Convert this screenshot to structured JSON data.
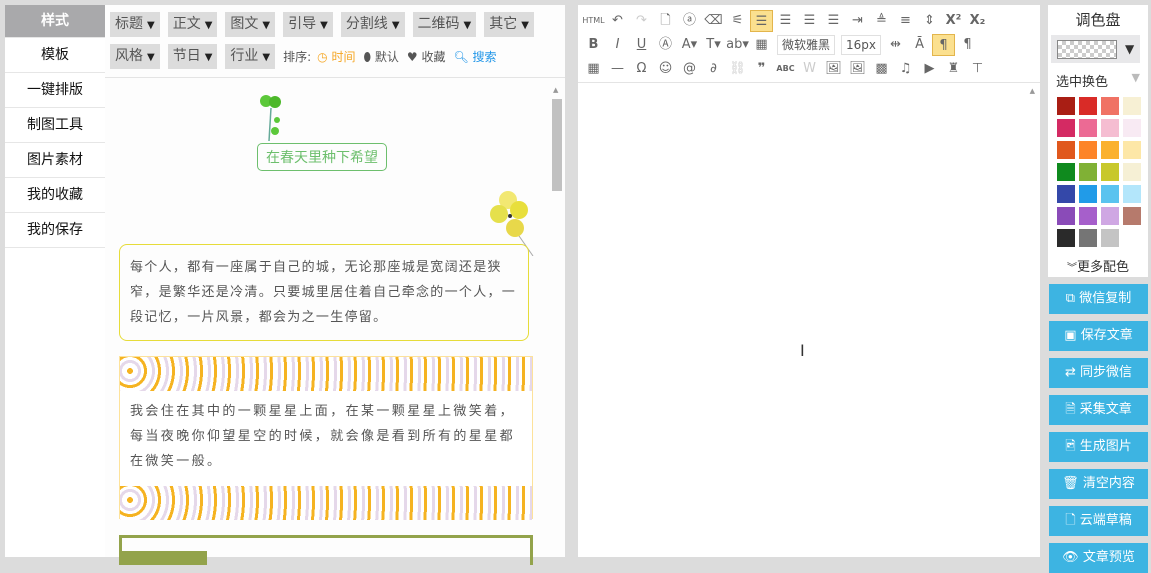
{
  "sidebar": {
    "items": [
      "样式",
      "模板",
      "一键排版",
      "制图工具",
      "图片素材",
      "我的收藏",
      "我的保存"
    ]
  },
  "tags": {
    "row1": [
      "标题",
      "正文",
      "图文",
      "引导",
      "分割线",
      "二维码",
      "其它"
    ],
    "row2": [
      "风格",
      "节日",
      "行业"
    ],
    "sort_label": "排序:",
    "sort_options": [
      "时间",
      "默认",
      "收藏"
    ],
    "search": "搜索"
  },
  "content": {
    "title": "在春天里种下希望",
    "card1": "每个人，都有一座属于自己的城，无论那座城是宽阔还是狭窄，是繁华还是冷清。只要城里居住着自己牵念的一个人，一段记忆，一片风景，都会为之一生停留。",
    "card2": "我会住在其中的一颗星星上面，在某一颗星星上微笑着，每当夜晚你仰望星空的时候，就会像是看到所有的星星都在微笑一般。"
  },
  "editor": {
    "html_btn": "HTML",
    "font_family": "微软雅黑",
    "font_size": "16px"
  },
  "palette": {
    "title": "调色盘",
    "subtitle": "选中换色",
    "more": "更多配色",
    "colors": [
      "#a91e14",
      "#d92b27",
      "#f07264",
      "#f7f0d4",
      "#d42a63",
      "#ec6a94",
      "#f5bdd1",
      "#f8eaf3",
      "#e0581d",
      "#fd8428",
      "#fbb12d",
      "#fde7a7",
      "#0f8a1e",
      "#80b135",
      "#c8c82b",
      "#f6f0d5",
      "#3448a9",
      "#219be8",
      "#5ac3ef",
      "#b3e6fb",
      "#8a4bb8",
      "#a65fcb",
      "#cfa7e3",
      "#b67a6c",
      "#2a2a2a",
      "#757575",
      "#c4c4c4"
    ]
  },
  "actions": [
    {
      "icon": "copy-icon",
      "glyph": "⧉",
      "label": "微信复制"
    },
    {
      "icon": "save-icon",
      "glyph": "▣",
      "label": "保存文章"
    },
    {
      "icon": "sync-icon",
      "glyph": "⇄",
      "label": "同步微信"
    },
    {
      "icon": "collect-icon",
      "glyph": "🗎",
      "label": "采集文章"
    },
    {
      "icon": "image-icon",
      "glyph": "🖻",
      "label": "生成图片"
    },
    {
      "icon": "trash-icon",
      "glyph": "🗑",
      "label": "清空内容"
    },
    {
      "icon": "cloud-draft-icon",
      "glyph": "🗋",
      "label": "云端草稿"
    },
    {
      "icon": "eye-icon",
      "glyph": "👁",
      "label": "文章预览"
    }
  ]
}
